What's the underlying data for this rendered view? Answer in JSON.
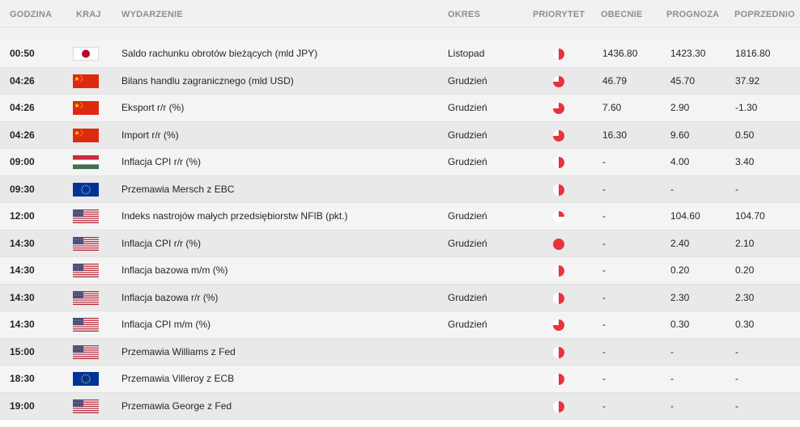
{
  "columns": {
    "time": "GODZINA",
    "country": "KRAJ",
    "event": "WYDARZENIE",
    "period": "OKRES",
    "priority": "PRIORYTET",
    "actual": "OBECNIE",
    "forecast": "PROGNOZA",
    "previous": "POPRZEDNIO"
  },
  "rows": [
    {
      "time": "00:50",
      "country": "jp",
      "event": "Saldo rachunku obrotów bieżących (mld JPY)",
      "period": "Listopad",
      "priority": 0.5,
      "actual": "1436.80",
      "forecast": "1423.30",
      "previous": "1816.80"
    },
    {
      "time": "04:26",
      "country": "cn",
      "event": "Bilans handlu zagranicznego (mld USD)",
      "period": "Grudzień",
      "priority": 0.75,
      "actual": "46.79",
      "forecast": "45.70",
      "previous": "37.92"
    },
    {
      "time": "04:26",
      "country": "cn",
      "event": "Eksport r/r (%)",
      "period": "Grudzień",
      "priority": 0.75,
      "actual": "7.60",
      "forecast": "2.90",
      "previous": "-1.30"
    },
    {
      "time": "04:26",
      "country": "cn",
      "event": "Import r/r (%)",
      "period": "Grudzień",
      "priority": 0.75,
      "actual": "16.30",
      "forecast": "9.60",
      "previous": "0.50"
    },
    {
      "time": "09:00",
      "country": "hu",
      "event": "Inflacja CPI r/r (%)",
      "period": "Grudzień",
      "priority": 0.5,
      "actual": "-",
      "forecast": "4.00",
      "previous": "3.40"
    },
    {
      "time": "09:30",
      "country": "eu",
      "event": "Przemawia Mersch z EBC",
      "period": "",
      "priority": 0.5,
      "actual": "-",
      "forecast": "-",
      "previous": "-"
    },
    {
      "time": "12:00",
      "country": "us",
      "event": "Indeks nastrojów małych przedsiębiorstw NFIB (pkt.)",
      "period": "Grudzień",
      "priority": 0.25,
      "actual": "-",
      "forecast": "104.60",
      "previous": "104.70"
    },
    {
      "time": "14:30",
      "country": "us",
      "event": "Inflacja CPI r/r (%)",
      "period": "Grudzień",
      "priority": 1.0,
      "actual": "-",
      "forecast": "2.40",
      "previous": "2.10"
    },
    {
      "time": "14:30",
      "country": "us",
      "event": "Inflacja bazowa m/m (%)",
      "period": "",
      "priority": 0.5,
      "actual": "-",
      "forecast": "0.20",
      "previous": "0.20"
    },
    {
      "time": "14:30",
      "country": "us",
      "event": "Inflacja bazowa r/r (%)",
      "period": "Grudzień",
      "priority": 0.5,
      "actual": "-",
      "forecast": "2.30",
      "previous": "2.30"
    },
    {
      "time": "14:30",
      "country": "us",
      "event": "Inflacja CPI m/m (%)",
      "period": "Grudzień",
      "priority": 0.75,
      "actual": "-",
      "forecast": "0.30",
      "previous": "0.30"
    },
    {
      "time": "15:00",
      "country": "us",
      "event": "Przemawia Williams z Fed",
      "period": "",
      "priority": 0.5,
      "actual": "-",
      "forecast": "-",
      "previous": "-"
    },
    {
      "time": "18:30",
      "country": "eu",
      "event": "Przemawia Villeroy z ECB",
      "period": "",
      "priority": 0.5,
      "actual": "-",
      "forecast": "-",
      "previous": "-"
    },
    {
      "time": "19:00",
      "country": "us",
      "event": "Przemawia George z Fed",
      "period": "",
      "priority": 0.5,
      "actual": "-",
      "forecast": "-",
      "previous": "-"
    }
  ],
  "colors": {
    "priority": "#e8323c",
    "header_text": "#8a8f96"
  }
}
